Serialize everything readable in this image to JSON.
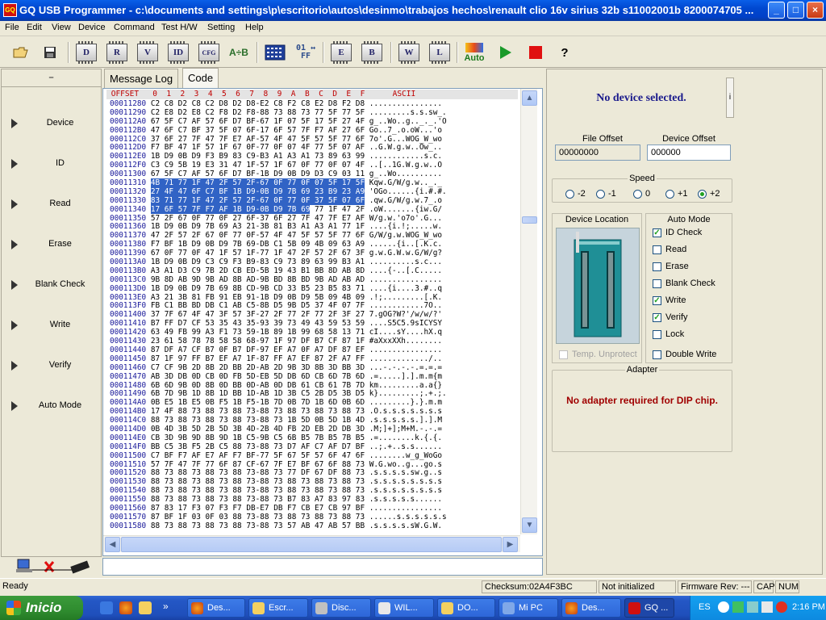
{
  "window": {
    "title": "GQ USB Programmer - c:\\documents and settings\\p\\escritorio\\autos\\desinmo\\trabajos hechos\\renault clio 16v sirius 32b s11002001b 8200074705 ...",
    "app_icon_label": "GQ",
    "controls": {
      "minimize": "_",
      "maximize": "□",
      "close": "×"
    }
  },
  "menu": [
    "File",
    "Edit",
    "View",
    "Device",
    "Command",
    "Test H/W",
    "Setting",
    "Help"
  ],
  "toolbar": {
    "buttons": [
      {
        "name": "open-icon",
        "label": ""
      },
      {
        "name": "save-icon",
        "label": ""
      },
      {
        "name": "chip-d-button",
        "label": "D"
      },
      {
        "name": "chip-r-button",
        "label": "R"
      },
      {
        "name": "chip-v-button",
        "label": "V"
      },
      {
        "name": "chip-id-button",
        "label": "ID"
      },
      {
        "name": "chip-cfg-button",
        "label": "CFG"
      },
      {
        "name": "a-to-b-button",
        "label": "A÷B"
      },
      {
        "name": "hex-icon",
        "label": ""
      },
      {
        "name": "fill-button",
        "label": "01 ↔ FF"
      },
      {
        "name": "chip-e-button",
        "label": "E"
      },
      {
        "name": "chip-b-button",
        "label": "B"
      },
      {
        "name": "chip-w-button",
        "label": "W"
      },
      {
        "name": "chip-l-button",
        "label": "L"
      },
      {
        "name": "auto-button",
        "label": "Auto"
      },
      {
        "name": "run-icon",
        "label": "▶"
      },
      {
        "name": "stop-icon",
        "label": ""
      },
      {
        "name": "help-icon",
        "label": "?"
      }
    ]
  },
  "left_panel": {
    "header": "–",
    "items": [
      "Device",
      "ID",
      "Read",
      "Erase",
      "Blank Check",
      "Write",
      "Verify",
      "Auto Mode"
    ]
  },
  "tabs": [
    "Message Log",
    "Code"
  ],
  "hex": {
    "header_offset": "OFFSET",
    "header_cols": [
      "0",
      "1",
      "2",
      "3",
      "4",
      "5",
      "6",
      "7",
      "8",
      "9",
      "A",
      "B",
      "C",
      "D",
      "E",
      "F"
    ],
    "header_ascii": "ASCII",
    "rows": [
      {
        "o": "00011280",
        "h": "C2 C8 D2 C8 C2 D8 D2 D8-E2 C8 F2 C8 E2 D8 F2 D8",
        "a": "................"
      },
      {
        "o": "00011290",
        "h": "C2 E8 D2 E8 C2 F8 D2 F8-88 73 88 73 77 5F 77 5F",
        "a": ".........s.s.sw_."
      },
      {
        "o": "000112A0",
        "h": "67 5F C7 AF 57 6F D7 BF-67 1F 07 5F 17 5F 27 4F",
        "a": "g_..Wo..g.._._.'O"
      },
      {
        "o": "000112B0",
        "h": "47 6F C7 BF 37 5F 07 6F-17 6F 57 7F F7 AF 27 6F",
        "a": "Go..7_.o.oW...'o"
      },
      {
        "o": "000112C0",
        "h": "37 6F 27 7F 47 7F E7 AF-57 4F 47 5F 57 5F 77 6F",
        "a": "7o'.G...WOG_W_wo"
      },
      {
        "o": "000112D0",
        "h": "F7 BF 47 1F 57 1F 67 0F-77 0F 07 4F 77 5F 07 AF",
        "a": "..G.W.g.w..Ow_.."
      },
      {
        "o": "000112E0",
        "h": "1B D9 0B D9 F3 B9 83 C9-B3 A1 A3 A1 73 89 63 99",
        "a": "............s.c."
      },
      {
        "o": "000112F0",
        "h": "C3 C9 5B 19 E3 31 47 1F-57 1F 67 0F 77 0F 07 4F",
        "a": "..[..1G.W.g.w..O"
      },
      {
        "o": "00011300",
        "h": "67 5F C7 AF 57 6F D7 BF-1B D9 0B D9 D3 C9 03 11",
        "a": "g_..Wo.........."
      },
      {
        "o": "00011310",
        "h": "4B 71 77 1F 47 2F 57 2F-67 0F 77 0F 07 5F 17 5F",
        "a": "Kqw.G/W/g.w.._._",
        "s": true
      },
      {
        "o": "00011320",
        "h": "27 4F 47 6F C7 BF 1B D9-0B D9 7B 69 23 B9 23 A9",
        "a": "'OGo......{i.#.#.",
        "s": true
      },
      {
        "o": "00011330",
        "h": "83 71 77 1F 47 2F 57 2F-67 0F 77 0F 37 5F 07 6F",
        "a": ".qw.G/W/g.w.7_.o",
        "s": true
      },
      {
        "o": "00011340",
        "h": "17 6F 57 7F F7 AF 1B D9-0B D9 7B 69",
        "a": ".oW.......{iw.G/",
        "s": true,
        "h2": " 77 1F 47 2F"
      },
      {
        "o": "00011350",
        "h": "57 2F 67 0F 77 0F 27 6F-37 6F 27 7F 47 7F E7 AF",
        "a": "W/g.w.'o7o'.G..."
      },
      {
        "o": "00011360",
        "h": "1B D9 0B D9 7B 69 A3 21-3B 81 B3 A1 A3 A1 77 1F",
        "a": "....{i.!;.....w."
      },
      {
        "o": "00011370",
        "h": "47 2F 57 2F 67 0F 77 0F-57 4F 47 5F 57 5F 77 6F",
        "a": "G/W/g.w.WOG_W_wo"
      },
      {
        "o": "00011380",
        "h": "F7 BF 1B D9 0B D9 7B 69-DB C1 5B 09 4B 09 63 A9",
        "a": "......{i..[.K.c."
      },
      {
        "o": "00011390",
        "h": "67 0F 77 0F 47 1F 57 1F-77 1F 47 2F 57 2F 67 3F",
        "a": "g.w.G.W.w.G/W/g?"
      },
      {
        "o": "000113A0",
        "h": "1B D9 0B D9 C3 C9 F3 B9-83 C9 73 89 63 99 B3 A1",
        "a": "..........s.c..."
      },
      {
        "o": "000113B0",
        "h": "A3 A1 D3 C9 7B 2D CB ED-5B 19 43 B1 BB 8D AB 8D",
        "a": "....{-..[.C....."
      },
      {
        "o": "000113C0",
        "h": "9B 8D AB 9D 9B AD 8B AD-9B BD 8B BD 9B AD AB AD",
        "a": "................"
      },
      {
        "o": "000113D0",
        "h": "1B D9 0B D9 7B 69 8B CD-9B CD 33 B5 23 B5 83 71",
        "a": "....{i....3.#..q"
      },
      {
        "o": "000113E0",
        "h": "A3 21 3B 81 FB 91 EB 91-1B D9 0B D9 5B 09 4B 09",
        "a": ".!;.........[.K."
      },
      {
        "o": "000113F0",
        "h": "FB C1 BB BD DB C1 AB C5-8B D5 9B D5 37 4F 07 7F",
        "a": "............7O.."
      },
      {
        "o": "00011400",
        "h": "37 7F 67 4F 47 3F 57 3F-27 2F 77 2F 77 2F 3F 27",
        "a": "7.gOG?W?'/w/w/?'"
      },
      {
        "o": "00011410",
        "h": "B7 FF D7 CF 53 35 43 35-93 39 73 49 43 59 53 59",
        "a": "....S5C5.9sICYSY"
      },
      {
        "o": "00011420",
        "h": "63 49 FB 99 A3 F1 73 59-1B 89 1B 99 68 58 13 71",
        "a": "cI....sY....hX.q"
      },
      {
        "o": "00011430",
        "h": "23 61 58 78 78 58 58 68-97 1F 97 DF B7 CF 87 1F",
        "a": "#aXxxXXh........"
      },
      {
        "o": "00011440",
        "h": "87 DF A7 CF B7 0F B7 DF-97 EF A7 0F A7 DF 87 EF",
        "a": "................"
      },
      {
        "o": "00011450",
        "h": "87 1F 97 FF B7 EF A7 1F-87 FF A7 EF 87 2F A7 FF",
        "a": "............./.."
      },
      {
        "o": "00011460",
        "h": "C7 CF 9B 2D 8B 2D BB 2D-AB 2D 9B 3D 8B 3D BB 3D",
        "a": "...-.-.-.-.=.=.="
      },
      {
        "o": "00011470",
        "h": "AB 3D DB 0D CB 0D FB 5D-EB 5D DB 6D CB 6D 7B 6D",
        "a": ".=.....].].m.m{m"
      },
      {
        "o": "00011480",
        "h": "6B 6D 9B 0D 8B 0D BB 0D-AB 0D DB 61 CB 61 7B 7D",
        "a": "km.........a.a{}"
      },
      {
        "o": "00011490",
        "h": "6B 7D 9B 1D 8B 1D BB 1D-AB 1D 3B C5 2B D5 3B D5",
        "a": "k}.........;.+.;."
      },
      {
        "o": "000114A0",
        "h": "0B E5 1B E5 0B F5 1B F5-1B 7D 0B 7D 1B 6D 0B 6D",
        "a": ".........}.}.m.m"
      },
      {
        "o": "000114B0",
        "h": "17 4F 88 73 88 73 88 73-88 73 88 73 88 73 88 73",
        "a": ".O.s.s.s.s.s.s.s"
      },
      {
        "o": "000114C0",
        "h": "88 73 88 73 88 73 88 73-88 73 1B 5D 0B 5D 1B 4D",
        "a": ".s.s.s.s.s.].].M"
      },
      {
        "o": "000114D0",
        "h": "0B 4D 3B 5D 2B 5D 3B 4D-2B 4D FB 2D EB 2D DB 3D",
        "a": ".M;]+];M+M.-.-.="
      },
      {
        "o": "000114E0",
        "h": "CB 3D 9B 9D 8B 9D 1B C5-9B C5 6B B5 7B B5 7B B5",
        "a": ".=........k.{.{."
      },
      {
        "o": "000114F0",
        "h": "BB C5 3B F5 2B C5 88 73-88 73 D7 AF C7 AF D7 BF",
        "a": "..;.+..s.s......"
      },
      {
        "o": "00011500",
        "h": "C7 BF F7 AF E7 AF F7 BF-77 5F 67 5F 57 6F 47 6F",
        "a": "........w_g_WoGo"
      },
      {
        "o": "00011510",
        "h": "57 7F 47 7F 77 6F 87 CF-67 7F E7 BF 67 6F 88 73",
        "a": "W.G.wo..g...go.s"
      },
      {
        "o": "00011520",
        "h": "88 73 88 73 88 73 88 73-88 73 77 DF 67 DF 88 73",
        "a": ".s.s.s.s.sw.g..s"
      },
      {
        "o": "00011530",
        "h": "88 73 88 73 88 73 88 73-88 73 88 73 88 73 88 73",
        "a": ".s.s.s.s.s.s.s.s"
      },
      {
        "o": "00011540",
        "h": "88 73 88 73 88 73 88 73-88 73 88 73 88 73 88 73",
        "a": ".s.s.s.s.s.s.s.s"
      },
      {
        "o": "00011550",
        "h": "88 73 88 73 88 73 88 73-88 73 B7 83 A7 83 97 83",
        "a": ".s.s.s.s.s......"
      },
      {
        "o": "00011560",
        "h": "87 83 17 F3 07 F3 F7 DB-E7 DB F7 CB E7 CB 97 BF",
        "a": "................"
      },
      {
        "o": "00011570",
        "h": "87 BF 1F 03 0F 03 88 73-88 73 88 73 88 73 88 73",
        "a": "......s.s.s.s.s.s"
      },
      {
        "o": "00011580",
        "h": "88 73 88 73 88 73 88 73-88 73 57 AB 47 AB 57 BB",
        "a": ".s.s.s.s.sW.G.W."
      }
    ]
  },
  "right_panel": {
    "device_status": "No device selected.",
    "info_button": "i",
    "file_offset_label": "File Offset",
    "file_offset_value": "00000000",
    "device_offset_label": "Device Offset",
    "device_offset_value": "000000",
    "speed_label": "Speed",
    "speed_options": [
      "-2",
      "-1",
      "0",
      "+1",
      "+2"
    ],
    "speed_selected": "+2",
    "device_location_label": "Device Location",
    "temp_unprotect_label": "Temp. Unprotect",
    "auto_mode_label": "Auto Mode",
    "auto_mode_items": [
      {
        "label": "ID Check",
        "checked": true
      },
      {
        "label": "Read",
        "checked": false
      },
      {
        "label": "Erase",
        "checked": false
      },
      {
        "label": "Blank Check",
        "checked": false
      },
      {
        "label": "Write",
        "checked": true
      },
      {
        "label": "Verify",
        "checked": true
      },
      {
        "label": "Lock",
        "checked": false
      }
    ],
    "double_write_label": "Double Write",
    "adapter_label": "Adapter",
    "adapter_message": "No adapter required for DIP chip."
  },
  "statusbar": {
    "ready": "Ready",
    "checksum": "Checksum:02A4F3BC",
    "init": "Not initialized",
    "firmware": "Firmware Rev: ---",
    "cap": "CAP",
    "num": "NUM"
  },
  "taskbar": {
    "start_label": "Inicio",
    "tasks": [
      "Des...",
      "Escr...",
      "Disc...",
      "WIL...",
      "DO...",
      "Mi PC",
      "Des...",
      "GQ ..."
    ],
    "lang": "ES",
    "clock": "2:16 PM"
  },
  "colors": {
    "title_blue": "#0048d0",
    "selection": "#3163c5",
    "offset_text": "#1a1a9a",
    "header_red": "#c00000",
    "status_navy": "#1a1a8c",
    "adapter_red": "#a00000"
  }
}
